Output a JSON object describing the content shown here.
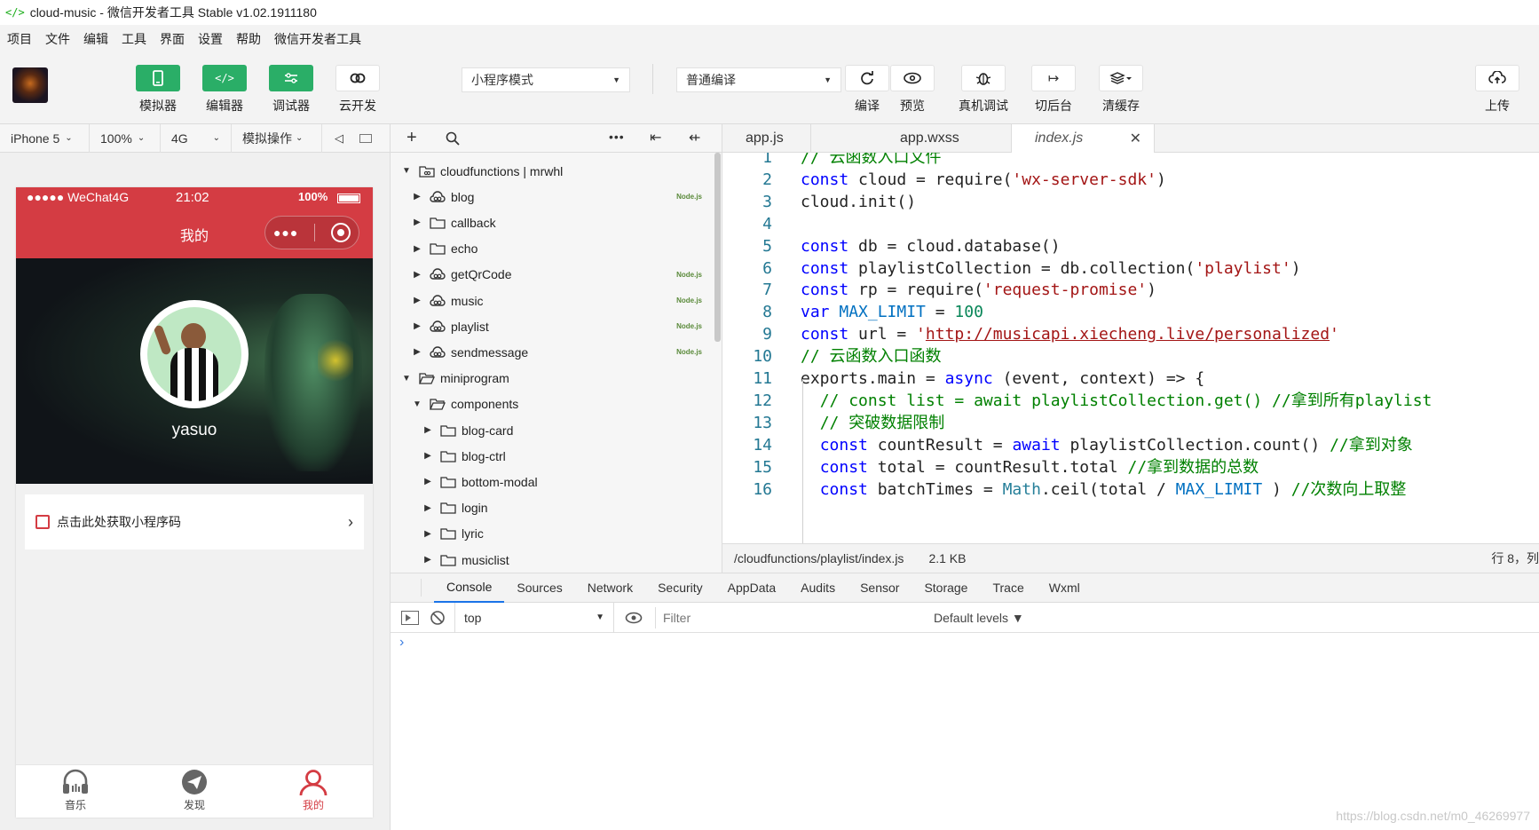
{
  "window": {
    "title": "cloud-music - 微信开发者工具 Stable v1.02.1911180",
    "app_icon": "code-bracket-icon"
  },
  "menu": [
    "项目",
    "文件",
    "编辑",
    "工具",
    "界面",
    "设置",
    "帮助",
    "微信开发者工具"
  ],
  "toolbar": {
    "simulator": "模拟器",
    "editor": "编辑器",
    "debugger": "调试器",
    "cloud": "云开发",
    "mode_select": "小程序模式",
    "compile_select": "普通编译",
    "compile": "编译",
    "preview": "预览",
    "real_debug": "真机调试",
    "background": "切后台",
    "clear_cache": "清缓存",
    "upload": "上传",
    "accent_color": "#2aae67"
  },
  "simulator_bar": {
    "device": "iPhone 5",
    "zoom": "100%",
    "network": "4G",
    "ops": "模拟操作"
  },
  "phone": {
    "carrier": "●●●●● WeChat4G",
    "time": "21:02",
    "battery": "100%",
    "nav_title": "我的",
    "username": "yasuo",
    "qr_text": "点击此处获取小程序码",
    "tabs": [
      "音乐",
      "发现",
      "我的"
    ],
    "theme_color": "#d43c43"
  },
  "tree": {
    "rows": [
      {
        "label": "cloudfunctions | mrwhl",
        "type": "cloud-root",
        "open": true,
        "nodejs": false
      },
      {
        "label": "blog",
        "type": "cloud",
        "open": false,
        "nodejs": true
      },
      {
        "label": "callback",
        "type": "folder",
        "open": false,
        "nodejs": false
      },
      {
        "label": "echo",
        "type": "folder",
        "open": false,
        "nodejs": false
      },
      {
        "label": "getQrCode",
        "type": "cloud",
        "open": false,
        "nodejs": true
      },
      {
        "label": "music",
        "type": "cloud",
        "open": false,
        "nodejs": true
      },
      {
        "label": "playlist",
        "type": "cloud",
        "open": false,
        "nodejs": true
      },
      {
        "label": "sendmessage",
        "type": "cloud",
        "open": false,
        "nodejs": true
      },
      {
        "label": "miniprogram",
        "type": "folder",
        "open": true,
        "nodejs": false
      },
      {
        "label": "components",
        "type": "folder",
        "open": true,
        "nodejs": false
      },
      {
        "label": "blog-card",
        "type": "folder",
        "open": false,
        "nodejs": false
      },
      {
        "label": "blog-ctrl",
        "type": "folder",
        "open": false,
        "nodejs": false
      },
      {
        "label": "bottom-modal",
        "type": "folder",
        "open": false,
        "nodejs": false
      },
      {
        "label": "login",
        "type": "folder",
        "open": false,
        "nodejs": false
      },
      {
        "label": "lyric",
        "type": "folder",
        "open": false,
        "nodejs": false
      },
      {
        "label": "musiclist",
        "type": "folder",
        "open": false,
        "nodejs": false
      }
    ],
    "nodejs_badge": "Node.js"
  },
  "editor": {
    "tabs": [
      "app.js",
      "app.wxss",
      "index.js"
    ],
    "lines": [
      {
        "n": "1",
        "html": "<span class=\"cm\">// 云函数入口文件</span>"
      },
      {
        "n": "2",
        "html": "<span class=\"kw\">const</span> cloud = require(<span class=\"str\">'wx-server-sdk'</span>)"
      },
      {
        "n": "3",
        "html": "cloud.init()"
      },
      {
        "n": "4",
        "html": ""
      },
      {
        "n": "5",
        "html": "<span class=\"kw\">const</span> db = cloud.database()"
      },
      {
        "n": "6",
        "html": "<span class=\"kw\">const</span> playlistCollection = db.collection(<span class=\"str\">'playlist'</span>)"
      },
      {
        "n": "7",
        "html": "<span class=\"kw\">const</span> rp = require(<span class=\"str\">'request-promise'</span>)"
      },
      {
        "n": "8",
        "html": "<span class=\"kw\">var</span> <span class=\"cn\">MAX_LIMIT</span> = <span class=\"num\">100</span>"
      },
      {
        "n": "9",
        "html": "<span class=\"kw\">const</span> url = <span class=\"str\">'<u>http://musicapi.xiecheng.live/personalized</u>'</span>"
      },
      {
        "n": "10",
        "html": "<span class=\"cm\">// 云函数入口函数</span>"
      },
      {
        "n": "11",
        "html": "exports.main = <span class=\"kw\">async</span> (event, context) => {"
      },
      {
        "n": "12",
        "html": "  <span class=\"cm\">// const list = await playlistCollection.get() //拿到所有playlist</span>"
      },
      {
        "n": "13",
        "html": "  <span class=\"cm\">// 突破数据限制</span>"
      },
      {
        "n": "14",
        "html": "  <span class=\"kw\">const</span> countResult = <span class=\"kw\">await</span> playlistCollection.count() <span class=\"cm\">//拿到对象</span>"
      },
      {
        "n": "15",
        "html": "  <span class=\"kw\">const</span> total = countResult.total <span class=\"cm\">//拿到数据的总数</span>"
      },
      {
        "n": "16",
        "html": "  <span class=\"kw\">const</span> batchTimes = <span class=\"ty\">Math</span>.ceil(total / <span class=\"cn\">MAX_LIMIT</span> ) <span class=\"cm\">//次数向上取整</span>"
      }
    ],
    "file_path": "/cloudfunctions/playlist/index.js",
    "file_size": "2.1 KB",
    "cursor": "行 8，列"
  },
  "devtools": {
    "tabs": [
      "Console",
      "Sources",
      "Network",
      "Security",
      "AppData",
      "Audits",
      "Sensor",
      "Storage",
      "Trace",
      "Wxml"
    ],
    "context": "top",
    "filter_placeholder": "Filter",
    "levels": "Default levels ▼",
    "prompt": "›"
  },
  "watermark": "https://blog.csdn.net/m0_46269977"
}
